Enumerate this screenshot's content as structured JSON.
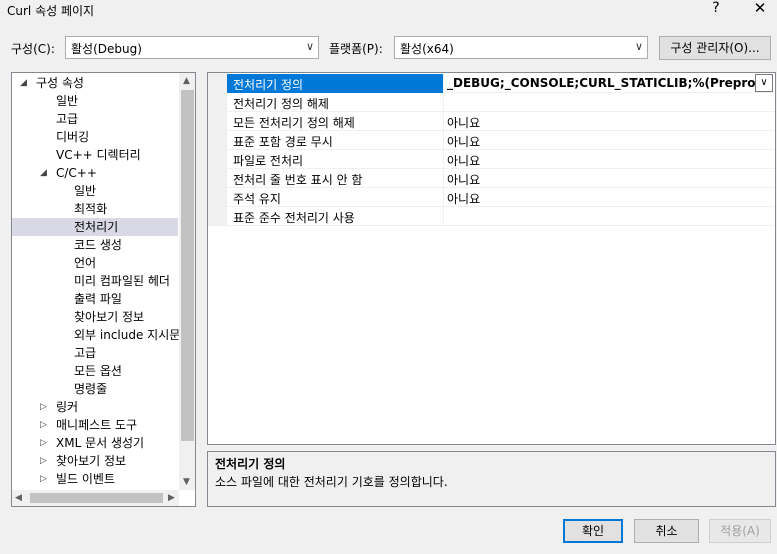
{
  "window": {
    "title": "Curl 속성 페이지",
    "help_glyph": "?",
    "close_glyph": "✕"
  },
  "config": {
    "label": "구성(C):",
    "value": "활성(Debug)",
    "platform_label": "플랫폼(P):",
    "platform_value": "활성(x64)",
    "manager_button": "구성 관리자(O)..."
  },
  "tree": {
    "items": [
      {
        "label": "구성 속성",
        "twisty": "◢"
      },
      {
        "label": "일반"
      },
      {
        "label": "고급"
      },
      {
        "label": "디버깅"
      },
      {
        "label": "VC++ 디렉터리"
      },
      {
        "label": "C/C++",
        "twisty": "◢"
      },
      {
        "label": "일반"
      },
      {
        "label": "최적화"
      },
      {
        "label": "전처리기",
        "selected": true
      },
      {
        "label": "코드 생성"
      },
      {
        "label": "언어"
      },
      {
        "label": "미리 컴파일된 헤더"
      },
      {
        "label": "출력 파일"
      },
      {
        "label": "찾아보기 정보"
      },
      {
        "label": "외부 include 지시문"
      },
      {
        "label": "고급"
      },
      {
        "label": "모든 옵션"
      },
      {
        "label": "명령줄"
      },
      {
        "label": "링커",
        "twisty": "▷"
      },
      {
        "label": "매니페스트 도구",
        "twisty": "▷"
      },
      {
        "label": "XML 문서 생성기",
        "twisty": "▷"
      },
      {
        "label": "찾아보기 정보",
        "twisty": "▷"
      },
      {
        "label": "빌드 이벤트",
        "twisty": "▷"
      }
    ]
  },
  "properties": {
    "rows": [
      {
        "name": "전처리기 정의",
        "value": "_DEBUG;_CONSOLE;CURL_STATICLIB;%(PreprocessorD",
        "selected": true
      },
      {
        "name": "전처리기 정의 해제",
        "value": ""
      },
      {
        "name": "모든 전처리기 정의 해제",
        "value": "아니요"
      },
      {
        "name": "표준 포함 경로 무시",
        "value": "아니요"
      },
      {
        "name": "파일로 전처리",
        "value": "아니요"
      },
      {
        "name": "전처리 줄 번호 표시 안 함",
        "value": "아니요"
      },
      {
        "name": "주석 유지",
        "value": "아니요"
      },
      {
        "name": "표준 준수 전처리기 사용",
        "value": ""
      }
    ]
  },
  "description": {
    "title": "전처리기 정의",
    "text": "소스 파일에 대한 전처리기 기호를 정의합니다."
  },
  "buttons": {
    "ok": "확인",
    "cancel": "취소",
    "apply": "적용(A)"
  }
}
